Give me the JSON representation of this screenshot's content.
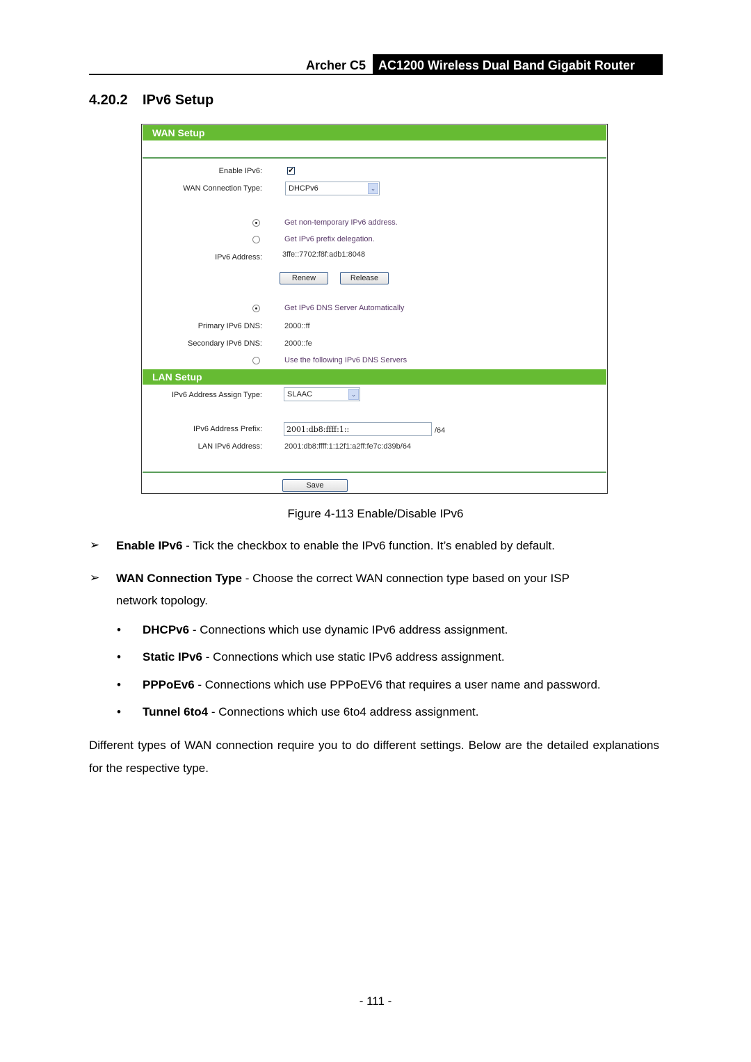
{
  "header": {
    "model": "Archer C5",
    "product": "AC1200 Wireless Dual Band Gigabit Router"
  },
  "section": {
    "number": "4.20.2",
    "title": "IPv6 Setup"
  },
  "figure": {
    "wan": {
      "title": "WAN Setup",
      "enable_label": "Enable IPv6:",
      "enable_checked": true,
      "enable_mark": "✔",
      "conn_type_label": "WAN Connection Type:",
      "conn_type_value": "DHCPv6",
      "address_options": [
        {
          "label": "Get non-temporary IPv6 address.",
          "selected": true
        },
        {
          "label": "Get IPv6 prefix delegation.",
          "selected": false
        }
      ],
      "ipv6_address_label": "IPv6 Address:",
      "ipv6_address_value": "3ffe::7702:f8f:adb1:8048",
      "renew_label": "Renew",
      "release_label": "Release",
      "dns_auto_label": "Get IPv6 DNS Server Automatically",
      "dns_auto_selected": true,
      "primary_dns_label": "Primary IPv6 DNS:",
      "primary_dns_value": "2000::ff",
      "secondary_dns_label": "Secondary IPv6 DNS:",
      "secondary_dns_value": "2000::fe",
      "dns_manual_label": "Use the following IPv6 DNS Servers",
      "dns_manual_selected": false
    },
    "lan": {
      "title": "LAN Setup",
      "assign_type_label": "IPv6 Address Assign Type:",
      "assign_type_value": "SLAAC",
      "prefix_label": "IPv6 Address Prefix:",
      "prefix_value": "2001:db8:ffff:1::",
      "prefix_suffix": "/64",
      "lan_address_label": "LAN IPv6 Address:",
      "lan_address_value": "2001:db8:ffff:1:12f1:a2ff:fe7c:d39b/64"
    },
    "save_label": "Save",
    "dropdown_glyph": "⌄"
  },
  "caption": "Figure 4-113 Enable/Disable IPv6",
  "bullets": [
    {
      "term": "Enable IPv6",
      "text": " - Tick the checkbox to enable the IPv6 function. It’s enabled by default."
    },
    {
      "term": "WAN Connection Type",
      "text": " - Choose the correct WAN connection type based on your ISP",
      "text2": "network topology."
    }
  ],
  "arrow_glyph": "➢",
  "dot_glyph": "•",
  "sub_bullets": [
    {
      "term": "DHCPv6",
      "text": " - Connections which use dynamic IPv6 address assignment."
    },
    {
      "term": "Static IPv6",
      "text": " - Connections which use static IPv6 address assignment."
    },
    {
      "term": "PPPoEv6",
      "text": " - Connections which use PPPoEV6 that requires a user name and password."
    },
    {
      "term": "Tunnel 6to4",
      "text": " - Connections which use 6to4 address assignment."
    }
  ],
  "closing_paragraph": "Different types of WAN connection require you to do different settings. Below are the detailed explanations for the respective type.",
  "page_number": "- 111 -"
}
